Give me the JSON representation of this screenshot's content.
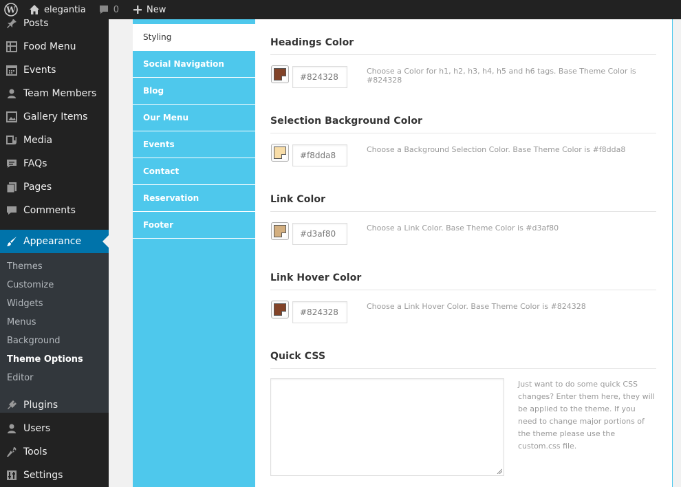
{
  "adminbar": {
    "site_name": "elegantia",
    "comments_count": "0",
    "new_label": "New"
  },
  "sidebar": {
    "items": [
      {
        "label": "Posts",
        "icon": "pin-icon"
      },
      {
        "label": "Food Menu",
        "icon": "menu-icon"
      },
      {
        "label": "Events",
        "icon": "calendar-icon"
      },
      {
        "label": "Team Members",
        "icon": "user-icon"
      },
      {
        "label": "Gallery Items",
        "icon": "gallery-icon"
      },
      {
        "label": "Media",
        "icon": "media-icon"
      },
      {
        "label": "FAQs",
        "icon": "faq-icon"
      },
      {
        "label": "Pages",
        "icon": "pages-icon"
      },
      {
        "label": "Comments",
        "icon": "comment-icon"
      },
      {
        "label": "Appearance",
        "icon": "brush-icon"
      },
      {
        "label": "Plugins",
        "icon": "plug-icon"
      },
      {
        "label": "Users",
        "icon": "users-icon"
      },
      {
        "label": "Tools",
        "icon": "wrench-icon"
      },
      {
        "label": "Settings",
        "icon": "settings-icon"
      }
    ],
    "submenu": [
      "Themes",
      "Customize",
      "Widgets",
      "Menus",
      "Background",
      "Theme Options",
      "Editor"
    ]
  },
  "tabs": [
    "Styling",
    "Social Navigation",
    "Blog",
    "Our Menu",
    "Events",
    "Contact",
    "Reservation",
    "Footer"
  ],
  "sections": [
    {
      "title": "Headings Color",
      "value": "#824328",
      "description": "Choose a Color for h1, h2, h3, h4, h5 and h6 tags. Base Theme Color is #824328",
      "color": "#824328"
    },
    {
      "title": "Selection Background Color",
      "value": "#f8dda8",
      "description": "Choose a Background Selection Color. Base Theme Color is #f8dda8",
      "color": "#f8dda8"
    },
    {
      "title": "Link Color",
      "value": "#d3af80",
      "description": "Choose a Link Color. Base Theme Color is #d3af80",
      "color": "#d3af80"
    },
    {
      "title": "Link Hover Color",
      "value": "#824328",
      "description": "Choose a Link Hover Color. Base Theme Color is #824328",
      "color": "#824328"
    }
  ],
  "quick_css": {
    "title": "Quick CSS",
    "value": "",
    "description": "Just want to do some quick CSS changes? Enter them here, they will be applied to the theme. If you need to change major portions of the theme please use the custom.css file."
  },
  "colors": {
    "accent": "#4ec8ec",
    "admin_active": "#0073aa"
  }
}
